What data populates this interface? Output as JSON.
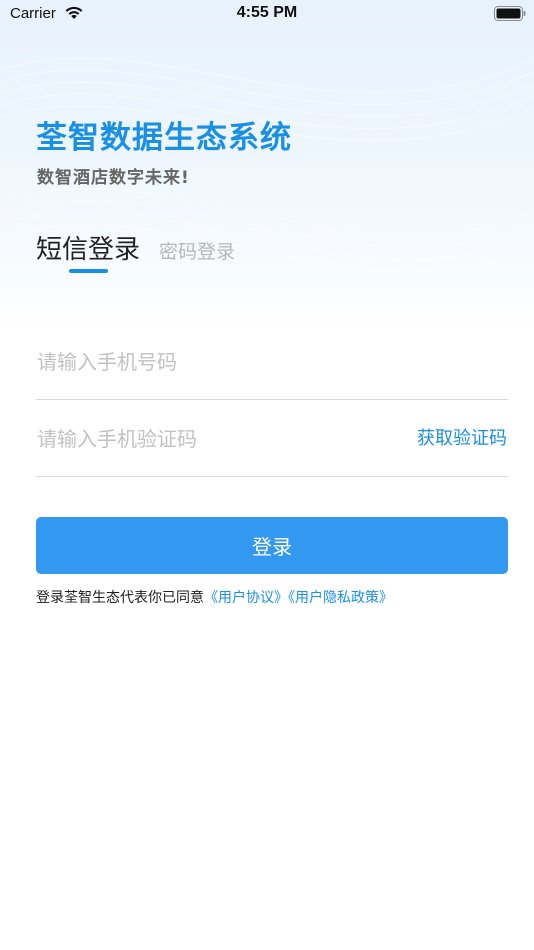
{
  "status_bar": {
    "carrier": "Carrier",
    "time": "4:55 PM"
  },
  "header": {
    "title": "荃智数据生态系统",
    "subtitle": "数智酒店数字未来!"
  },
  "tabs": [
    {
      "label": "短信登录",
      "active": true
    },
    {
      "label": "密码登录",
      "active": false
    }
  ],
  "form": {
    "phone_placeholder": "请输入手机号码",
    "phone_value": "",
    "code_placeholder": "请输入手机验证码",
    "code_value": "",
    "get_code_label": "获取验证码",
    "login_label": "登录"
  },
  "agreement": {
    "prefix": "登录荃智生态代表你已同意",
    "user_agreement": "《用户协议》",
    "privacy_policy": "《用户隐私政策》"
  },
  "colors": {
    "accent": "#1a8fe6",
    "button": "#3399f0",
    "placeholder": "#c2c2c2"
  },
  "icons": [
    "wifi-icon",
    "battery-icon"
  ]
}
